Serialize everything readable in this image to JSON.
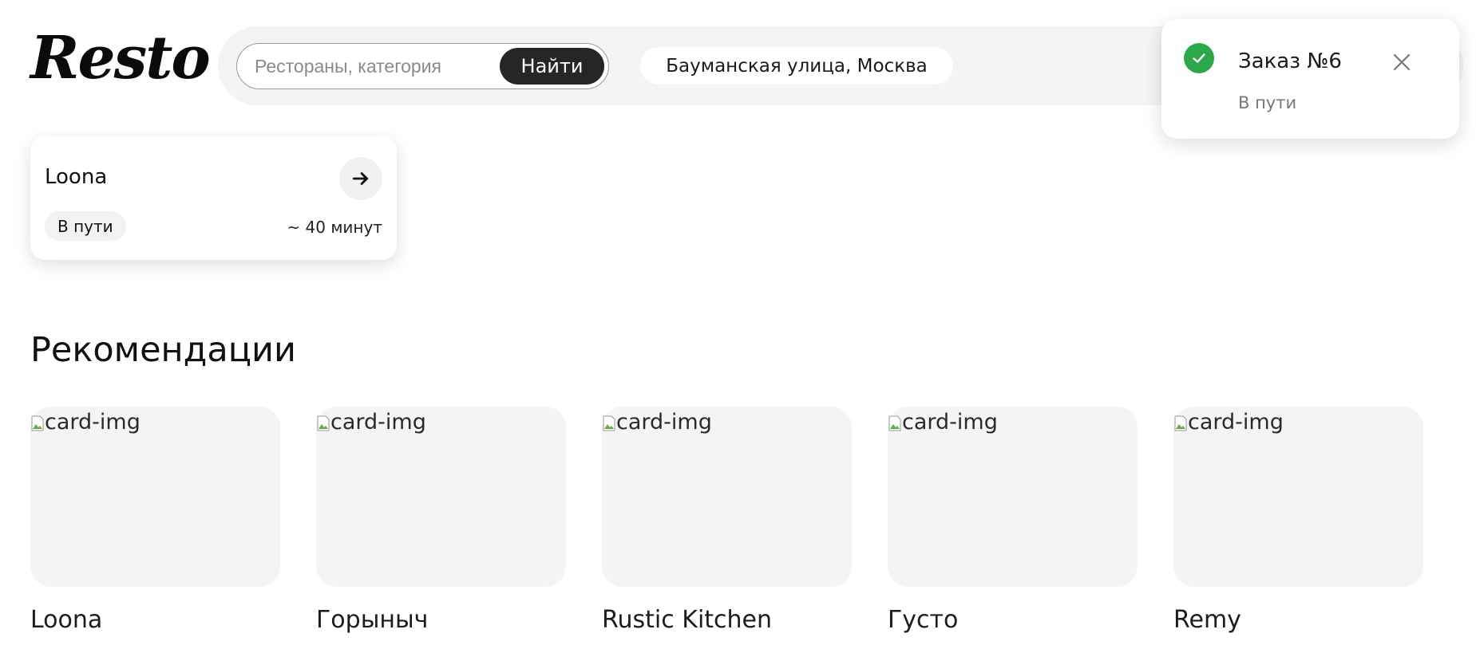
{
  "header": {
    "logo_text": "Resto",
    "search": {
      "placeholder": "Рестораны, категория",
      "value": "",
      "button_label": "Найти"
    },
    "address": "Бауманская улица, Москва"
  },
  "active_order": {
    "restaurant": "Loona",
    "status": "В пути",
    "eta": "~ 40 минут",
    "arrow_icon": "arrow-right-icon"
  },
  "recommendations": {
    "title": "Рекомендации",
    "items": [
      {
        "image_alt": "card-img",
        "name": "Loona"
      },
      {
        "image_alt": "card-img",
        "name": "Горыныч"
      },
      {
        "image_alt": "card-img",
        "name": "Rustic Kitchen"
      },
      {
        "image_alt": "card-img",
        "name": "Густо"
      },
      {
        "image_alt": "card-img",
        "name": "Remy"
      }
    ]
  },
  "toast": {
    "title": "Заказ №6",
    "subtitle": "В пути",
    "icon": "check-circle-icon",
    "close_icon": "close-icon"
  },
  "colors": {
    "header_bg": "#f4f4f4",
    "button_dark": "#262626",
    "success_green": "#2ba84a",
    "card_bg": "#f4f4f4"
  }
}
